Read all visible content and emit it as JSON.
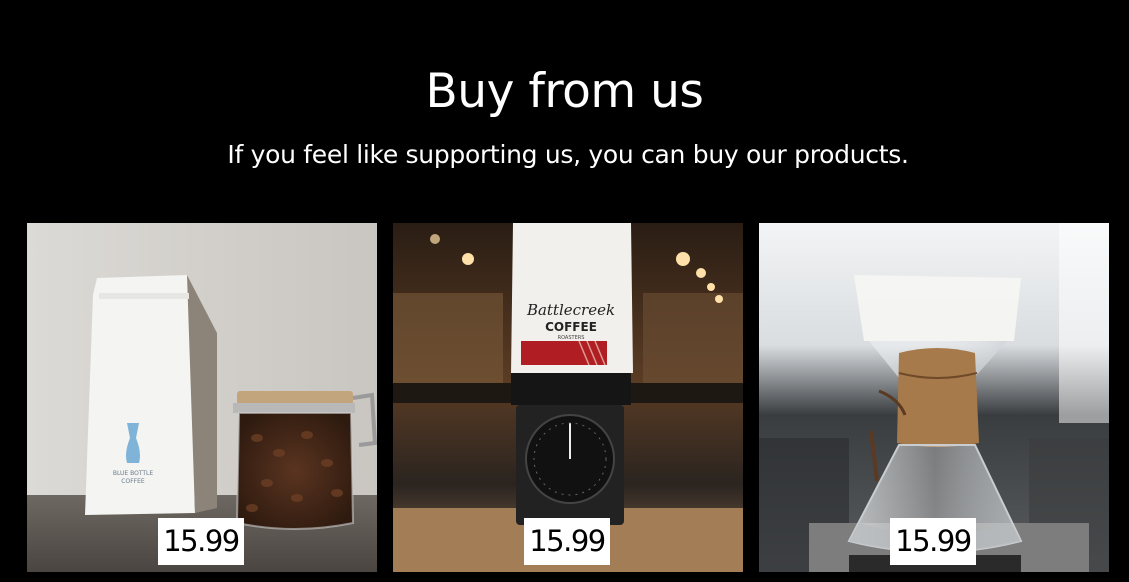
{
  "header": {
    "title": "Buy from us",
    "subtitle": "If you feel like supporting us, you can buy our products."
  },
  "products": [
    {
      "price": "15.99",
      "bag_label_line1": "BLUE BOTTLE",
      "bag_label_line2": "COFFEE"
    },
    {
      "price": "15.99",
      "brand_script": "Battlecreek",
      "brand_word": "COFFEE",
      "brand_sub": "ROASTERS"
    },
    {
      "price": "15.99"
    }
  ],
  "colors": {
    "background": "#000000",
    "text": "#ffffff",
    "price_tag": "#ffffff"
  }
}
